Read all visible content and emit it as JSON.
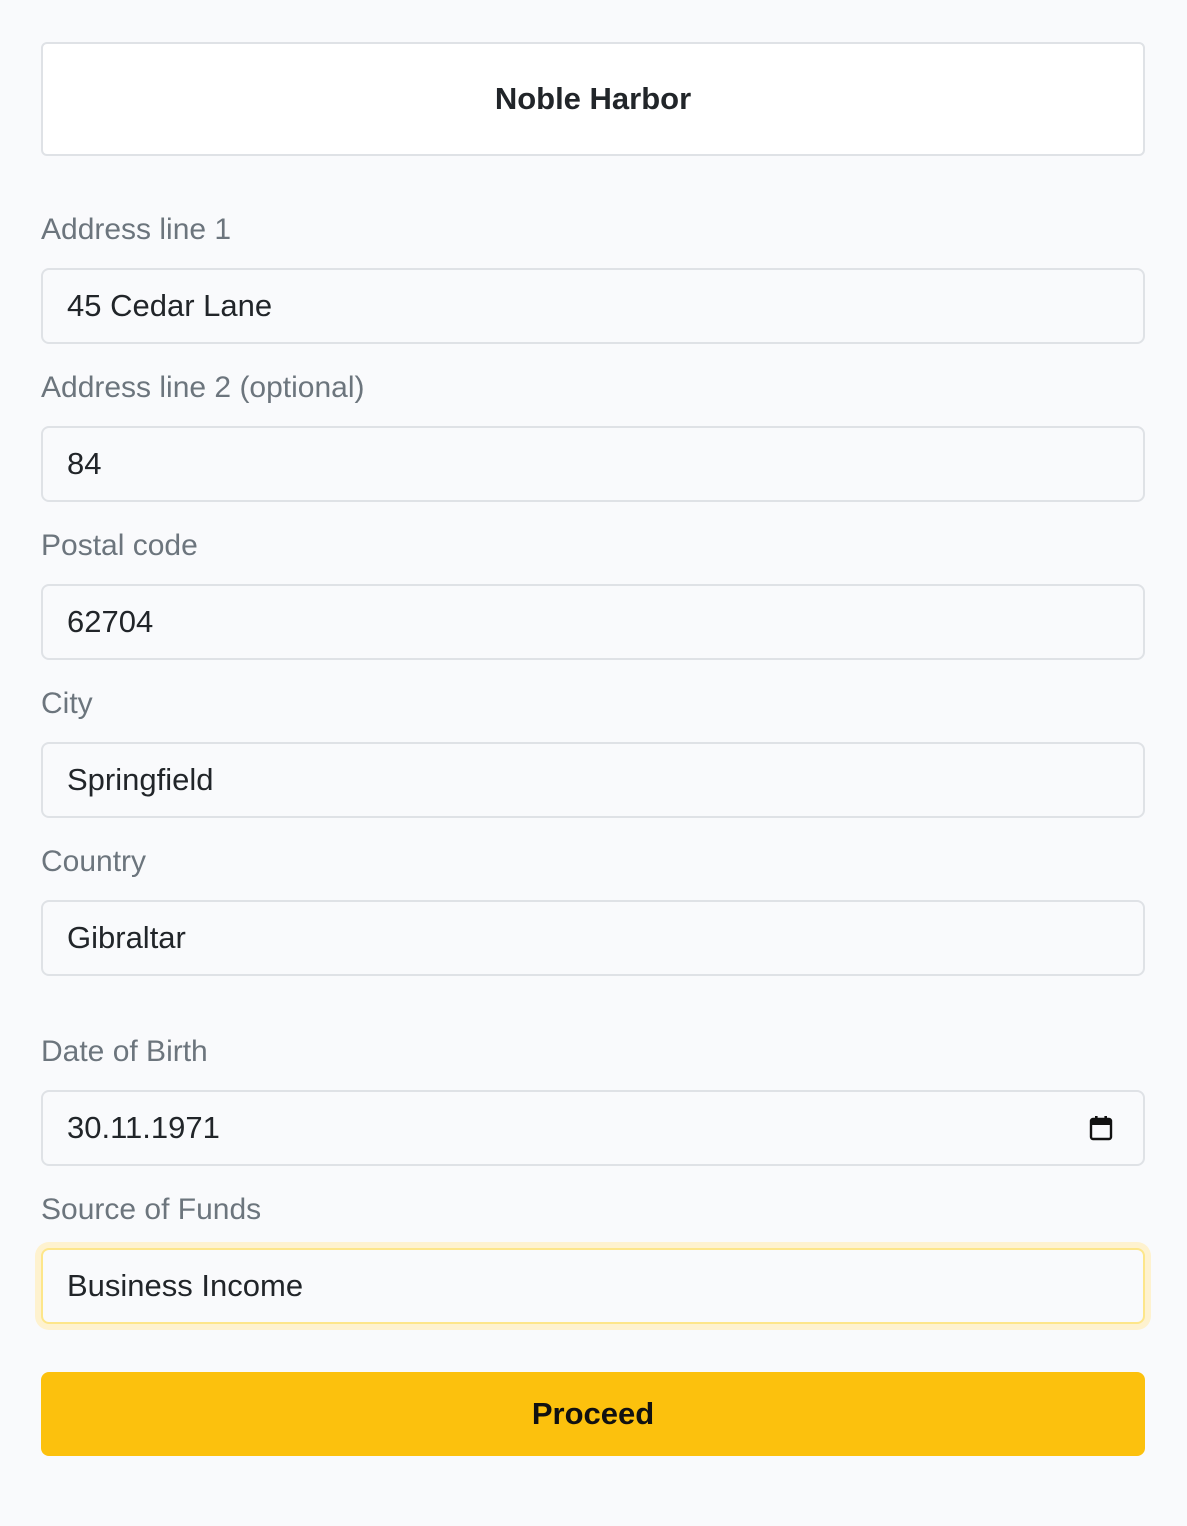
{
  "header": {
    "title": "Noble Harbor"
  },
  "fields": {
    "address1": {
      "label": "Address line 1",
      "value": "45 Cedar Lane"
    },
    "address2": {
      "label": "Address line 2 (optional)",
      "value": "84"
    },
    "postal": {
      "label": "Postal code",
      "value": "62704"
    },
    "city": {
      "label": "City",
      "value": "Springfield"
    },
    "country": {
      "label": "Country",
      "value": "Gibraltar"
    },
    "dob": {
      "label": "Date of Birth",
      "value": "30.11.1971",
      "icon": "calendar-icon"
    },
    "funds": {
      "label": "Source of Funds",
      "value": "Business Income"
    }
  },
  "actions": {
    "proceed_label": "Proceed"
  },
  "colors": {
    "accent": "#fcc10d",
    "background": "#f9fafc",
    "label": "#6c757d",
    "border": "#dfe2e6",
    "focus_ring": "#fef2cf"
  }
}
